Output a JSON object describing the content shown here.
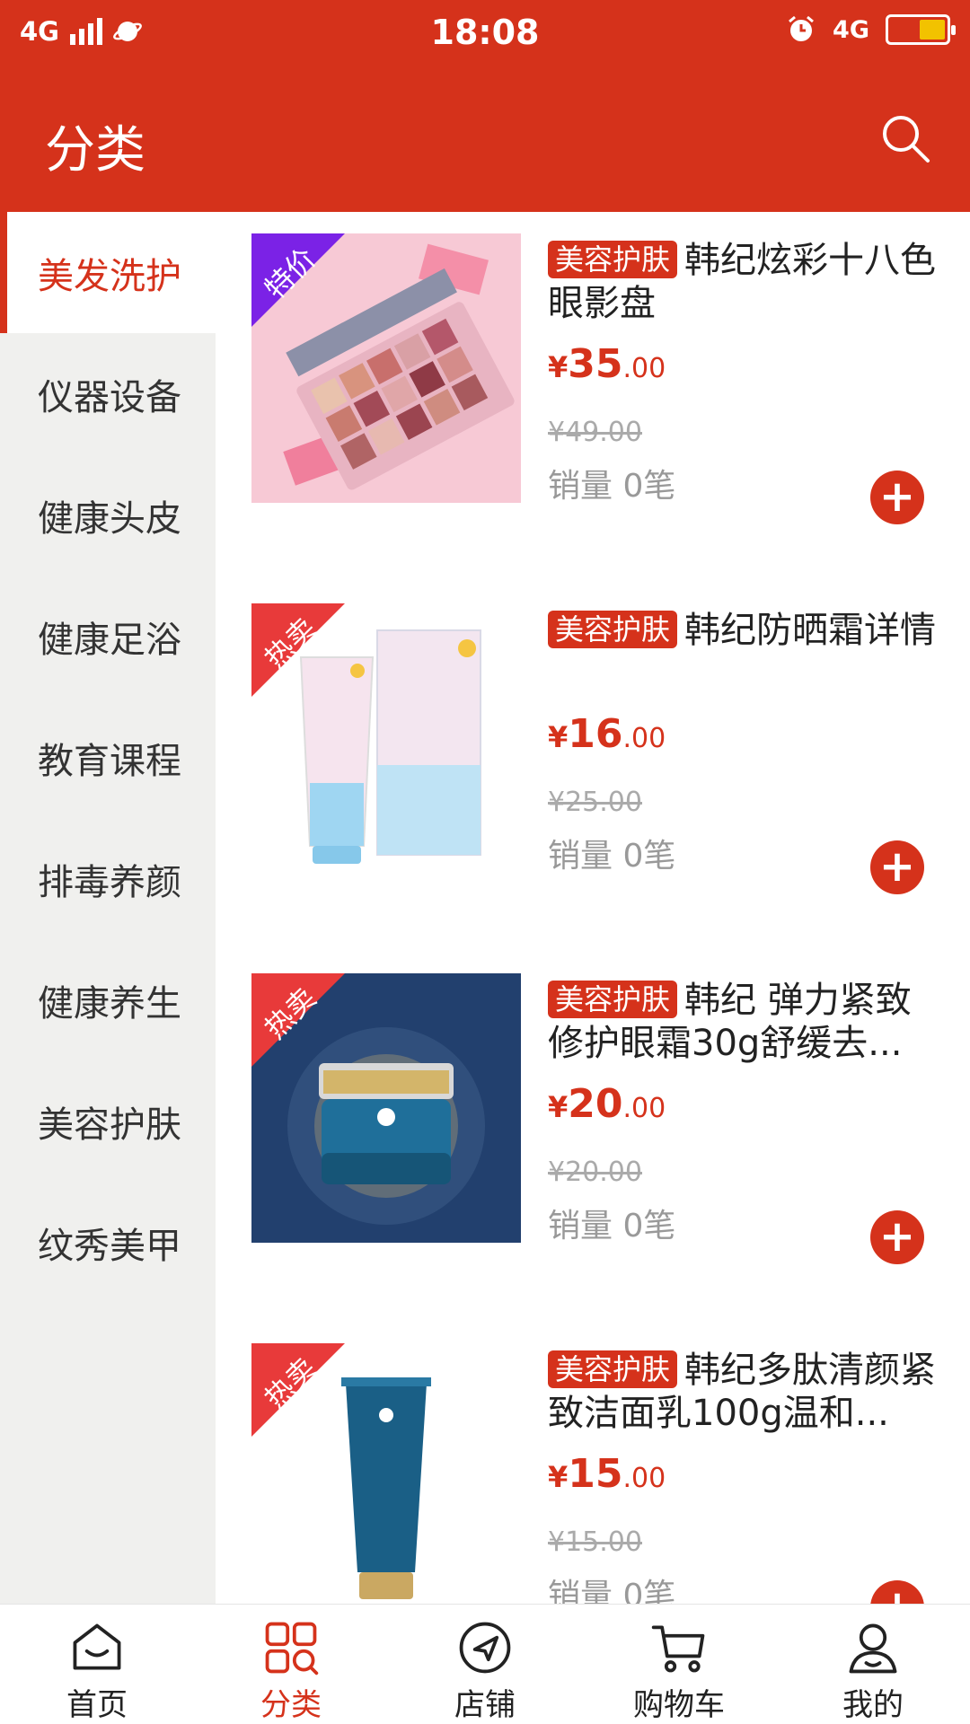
{
  "statusbar": {
    "network_left": "4G",
    "time": "18:08",
    "network_right": "4G"
  },
  "header": {
    "title": "分类"
  },
  "colors": {
    "brand_red": "#d5321b",
    "sidebar_bg": "#f0f0ee"
  },
  "sidebar": {
    "items": [
      {
        "label": "美发洗护",
        "active": true
      },
      {
        "label": "仪器设备"
      },
      {
        "label": "健康头皮"
      },
      {
        "label": "健康足浴"
      },
      {
        "label": "教育课程"
      },
      {
        "label": "排毒养颜"
      },
      {
        "label": "健康养生"
      },
      {
        "label": "美容护肤"
      },
      {
        "label": "纹秀美甲"
      }
    ]
  },
  "products": [
    {
      "ribbon": "特价",
      "ribbon_color": "#7b22e6",
      "tag": "美容护肤",
      "title": "韩纪炫彩十八色眼影盘",
      "currency": "¥",
      "price_int": "35",
      "price_dec": ".00",
      "original_price": "¥49.00",
      "sales": "销量 0笔"
    },
    {
      "ribbon": "热卖",
      "ribbon_color": "#e83a3a",
      "tag": "美容护肤",
      "title": "韩纪防晒霜详情",
      "currency": "¥",
      "price_int": "16",
      "price_dec": ".00",
      "original_price": "¥25.00",
      "sales": "销量 0笔"
    },
    {
      "ribbon": "热卖",
      "ribbon_color": "#e83a3a",
      "tag": "美容护肤",
      "title": "韩纪 弹力紧致修护眼霜30g舒缓去...",
      "currency": "¥",
      "price_int": "20",
      "price_dec": ".00",
      "original_price": "¥20.00",
      "sales": "销量 0笔"
    },
    {
      "ribbon": "热卖",
      "ribbon_color": "#e83a3a",
      "tag": "美容护肤",
      "title": "韩纪多肽清颜紧致洁面乳100g温和...",
      "currency": "¥",
      "price_int": "15",
      "price_dec": ".00",
      "original_price": "¥15.00",
      "sales": "销量 0笔"
    }
  ],
  "bottom_nav": [
    {
      "label": "首页",
      "icon": "home-icon"
    },
    {
      "label": "分类",
      "icon": "category-grid-icon",
      "active": true
    },
    {
      "label": "店铺",
      "icon": "store-compass-icon"
    },
    {
      "label": "购物车",
      "icon": "cart-icon"
    },
    {
      "label": "我的",
      "icon": "user-icon"
    }
  ]
}
